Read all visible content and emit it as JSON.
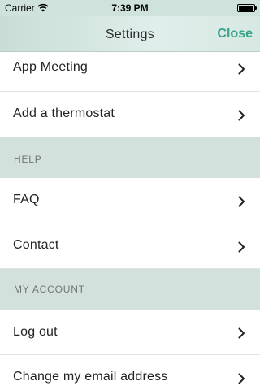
{
  "status_bar": {
    "carrier": "Carrier",
    "time": "7:39 PM"
  },
  "nav": {
    "title": "Settings",
    "close_label": "Close",
    "accent_color": "#3aa38a"
  },
  "rows": {
    "app_meeting": "App Meeting",
    "add_thermostat": "Add a thermostat",
    "help_header": "HELP",
    "faq": "FAQ",
    "contact": "Contact",
    "account_header": "MY ACCOUNT",
    "log_out": "Log out",
    "change_email": "Change my email address"
  }
}
